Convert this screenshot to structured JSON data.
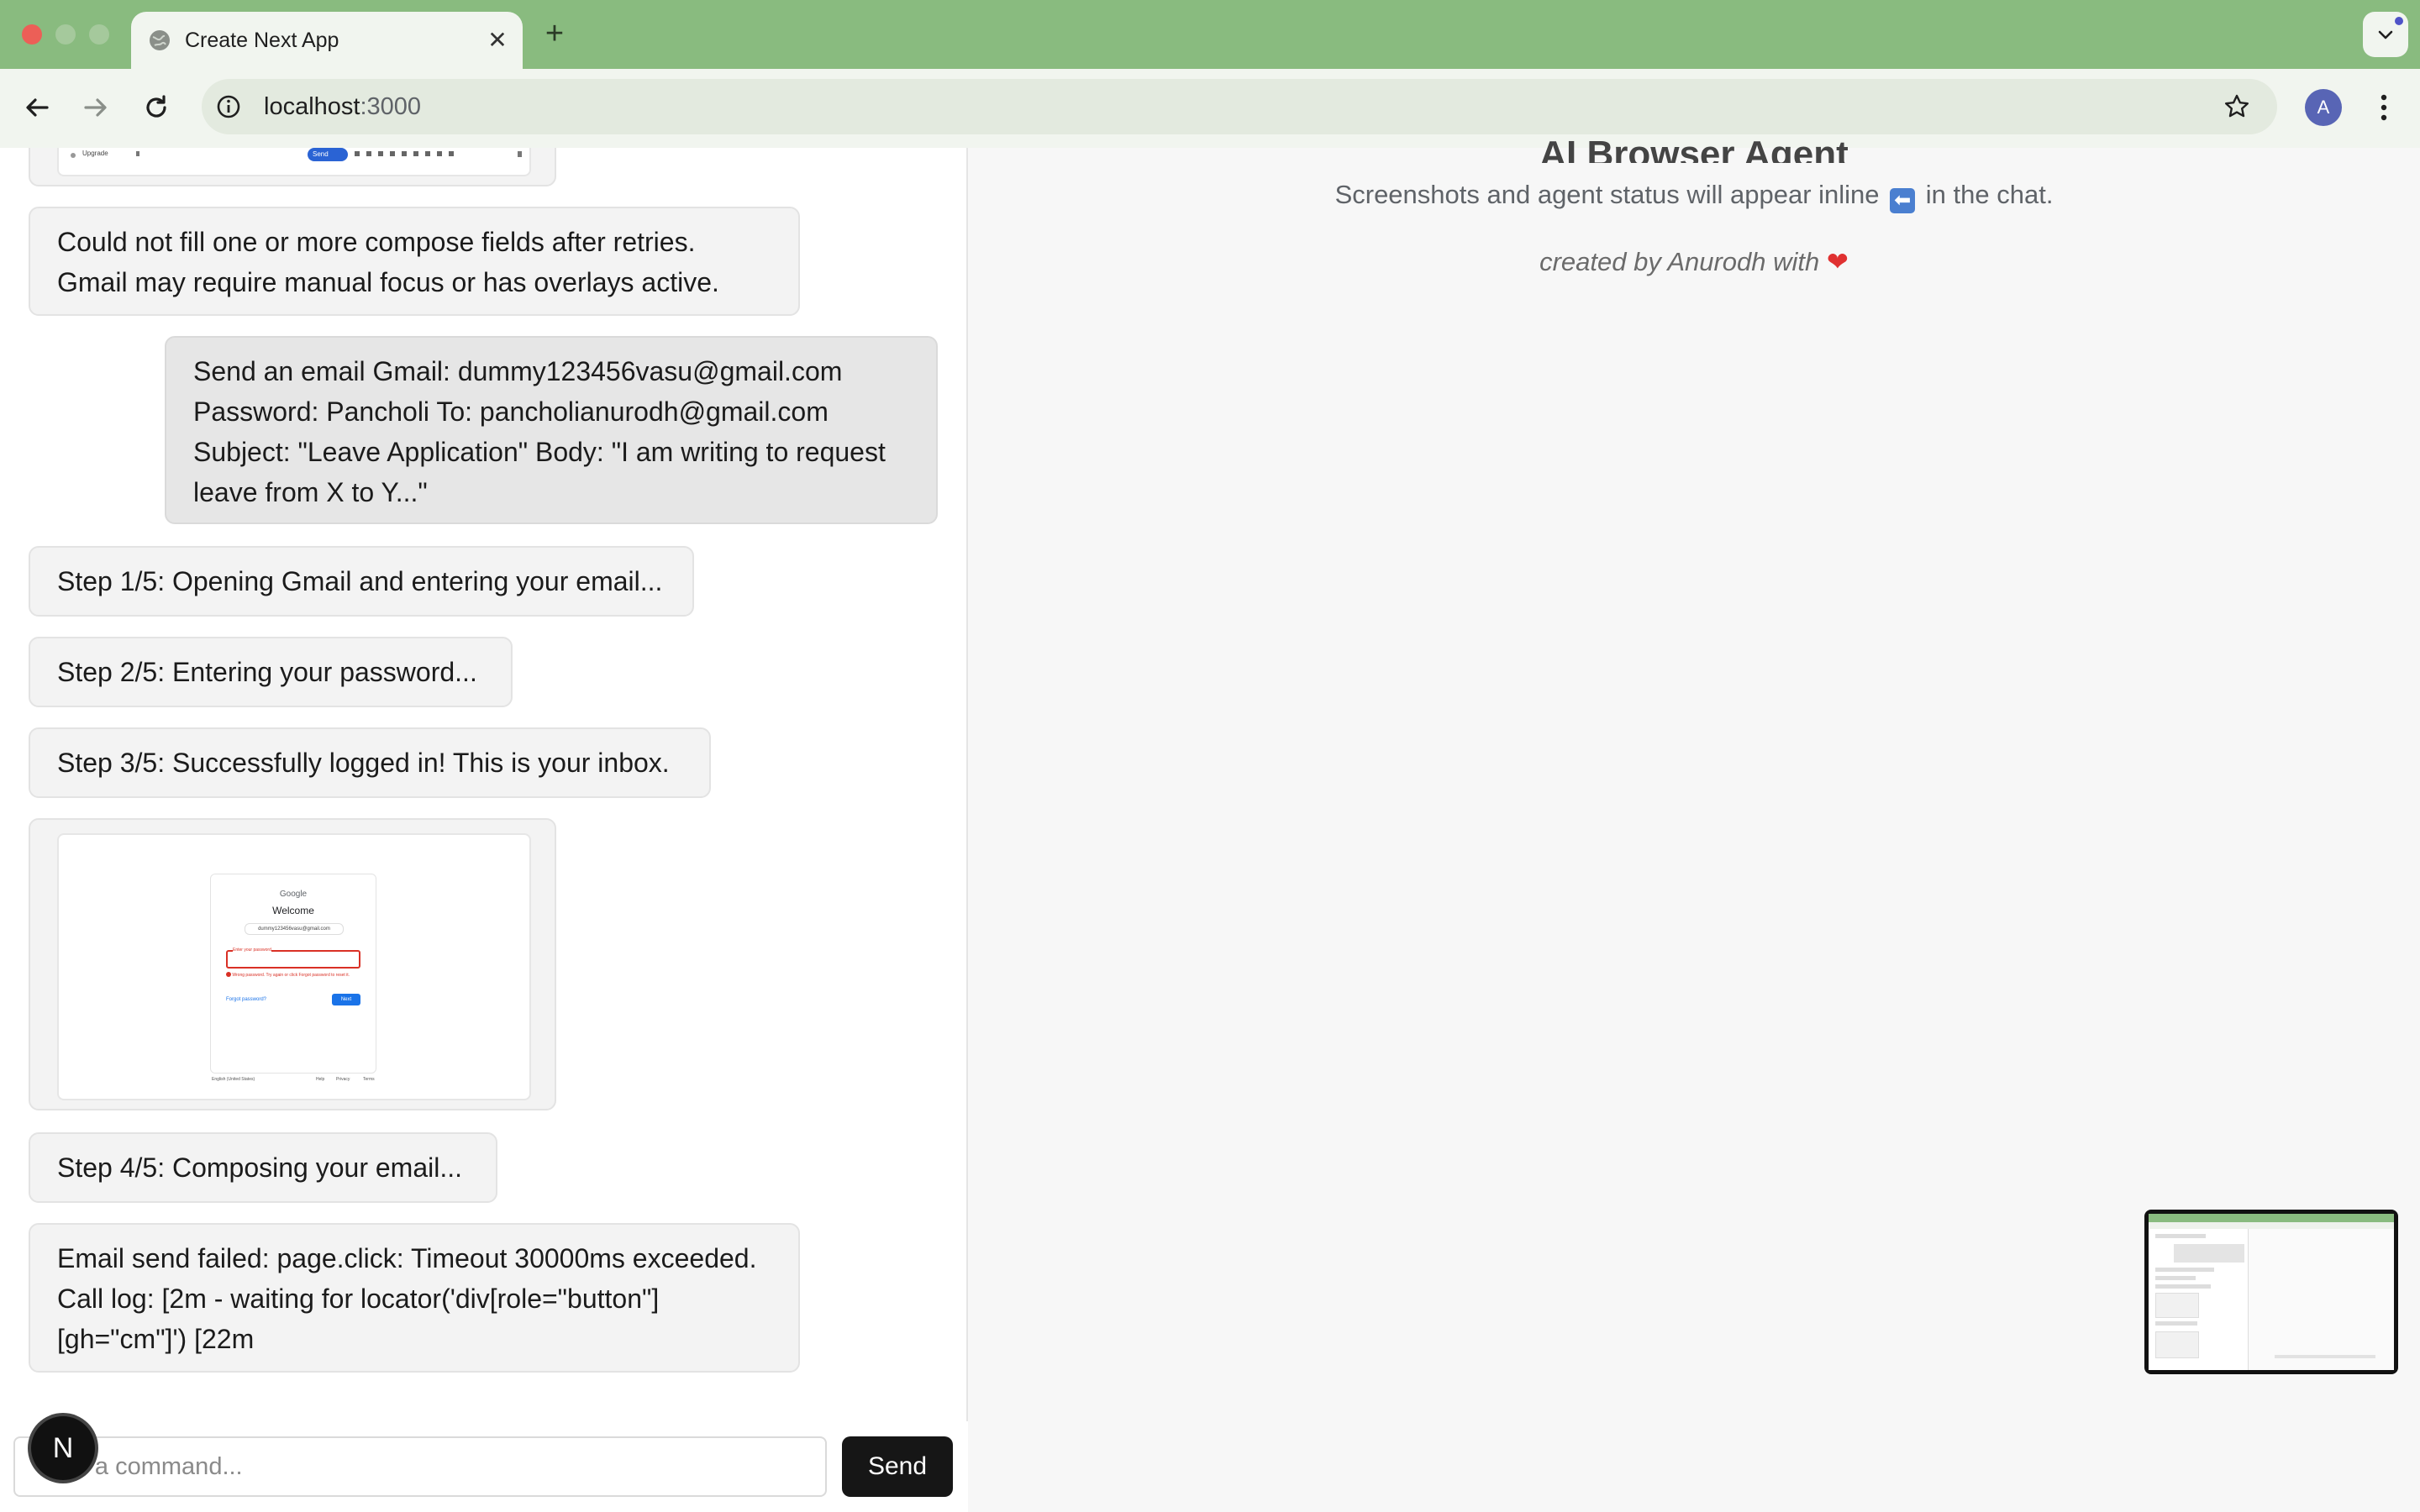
{
  "browser": {
    "tab_title": "Create Next App",
    "tab_close": "✕",
    "new_tab": "+",
    "url_host": "localhost",
    "url_port": ":3000",
    "profile_initial": "A"
  },
  "chat": {
    "messages": [
      {
        "role": "agent",
        "lines": [
          "Could not fill one or more compose fields after retries.",
          "Gmail may require manual focus or has overlays active."
        ]
      },
      {
        "role": "user",
        "lines": [
          "Send an email Gmail: dummy123456vasu@gmail.com",
          "Password: Pancholi To: pancholianurodh@gmail.com",
          "Subject: \"Leave Application\" Body: \"I am writing to request",
          "leave from X to Y...\""
        ]
      },
      {
        "role": "agent",
        "lines": [
          "Step 1/5: Opening Gmail and entering your email..."
        ]
      },
      {
        "role": "agent",
        "lines": [
          "Step 2/5: Entering your password..."
        ]
      },
      {
        "role": "agent",
        "lines": [
          "Step 3/5: Successfully logged in! This is your inbox."
        ]
      },
      {
        "role": "agent",
        "lines": [
          "Step 4/5: Composing your email..."
        ]
      },
      {
        "role": "agent",
        "lines": [
          "Email send failed: page.click: Timeout 30000ms exceeded.",
          "Call log:  [2m - waiting for locator('div[role=\"button\"]",
          "[gh=\"cm\"]') [22m"
        ]
      }
    ],
    "screenshot": {
      "google_logo": "Google",
      "welcome": "Welcome",
      "account": "dummy123456vasu@gmail.com",
      "password_label": "Enter your password",
      "error": "Wrong password. Try again or click Forgot password to reset it.",
      "forgot": "Forgot password?",
      "next": "Next",
      "language": "English (United States)",
      "help": "Help",
      "privacy": "Privacy",
      "terms": "Terms"
    },
    "top_screenshot": {
      "upgrade": "Upgrade",
      "send": "Send"
    }
  },
  "composer": {
    "placeholder": "Type a command...",
    "send_label": "Send",
    "badge": "N"
  },
  "right_panel": {
    "title": "AI Browser Agent",
    "subtitle_before": "Screenshots and agent status will appear inline",
    "subtitle_emoji": "⬅",
    "subtitle_after": "in the chat.",
    "credit": "created by Anurodh with",
    "credit_emoji": "❤"
  }
}
